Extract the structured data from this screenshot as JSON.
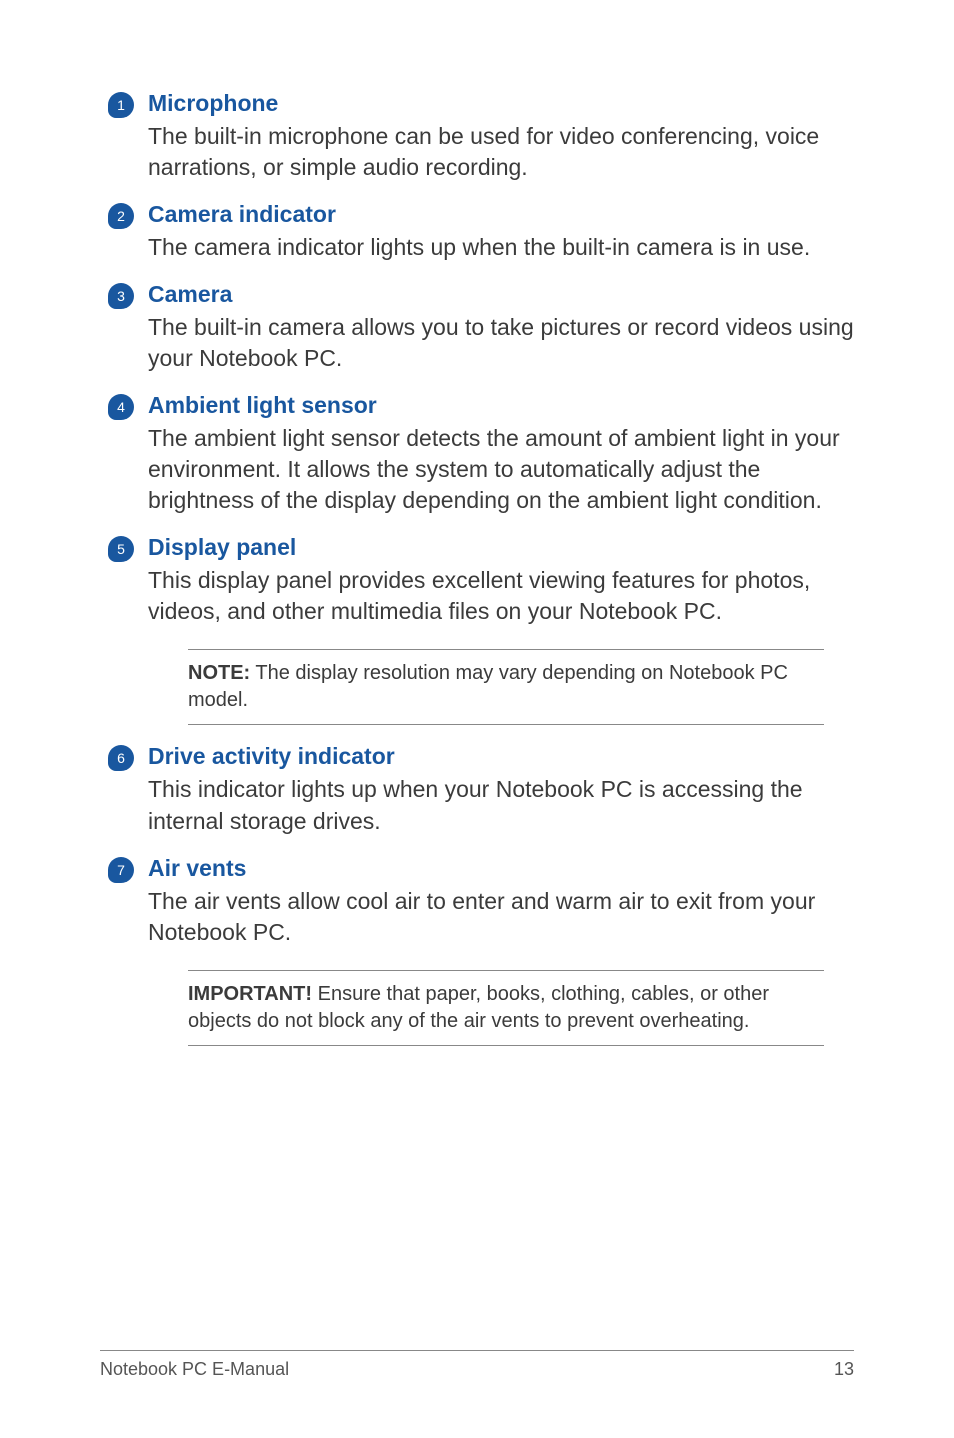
{
  "items": [
    {
      "num": "1",
      "title": "Microphone",
      "body": "The built-in microphone can be used for video conferencing, voice narrations, or simple audio recording."
    },
    {
      "num": "2",
      "title": "Camera indicator",
      "body": "The camera indicator lights up when the built-in camera is in use."
    },
    {
      "num": "3",
      "title": "Camera",
      "body": "The built-in camera allows you to take pictures or record videos using your Notebook PC."
    },
    {
      "num": "4",
      "title": "Ambient light sensor",
      "body": "The ambient light sensor detects the amount of ambient light in your environment. It allows the system to automatically adjust the brightness of the display depending on the ambient light condition."
    },
    {
      "num": "5",
      "title": "Display panel",
      "body": "This display panel provides excellent viewing features for photos, videos, and other multimedia files on your Notebook PC.",
      "note_label": "NOTE:",
      "note_text": " The display resolution may vary depending on Notebook PC model."
    },
    {
      "num": "6",
      "title": "Drive activity indicator",
      "body": "This indicator lights up when your Notebook PC is accessing the internal storage drives."
    },
    {
      "num": "7",
      "title": "Air vents",
      "body": "The air vents allow cool air to enter and warm air to exit from your Notebook PC.",
      "note_label": "IMPORTANT!",
      "note_text": " Ensure that paper, books, clothing, cables, or other objects do not block any of the air vents to prevent overheating."
    }
  ],
  "footer": {
    "left": "Notebook PC E-Manual",
    "right": "13"
  }
}
